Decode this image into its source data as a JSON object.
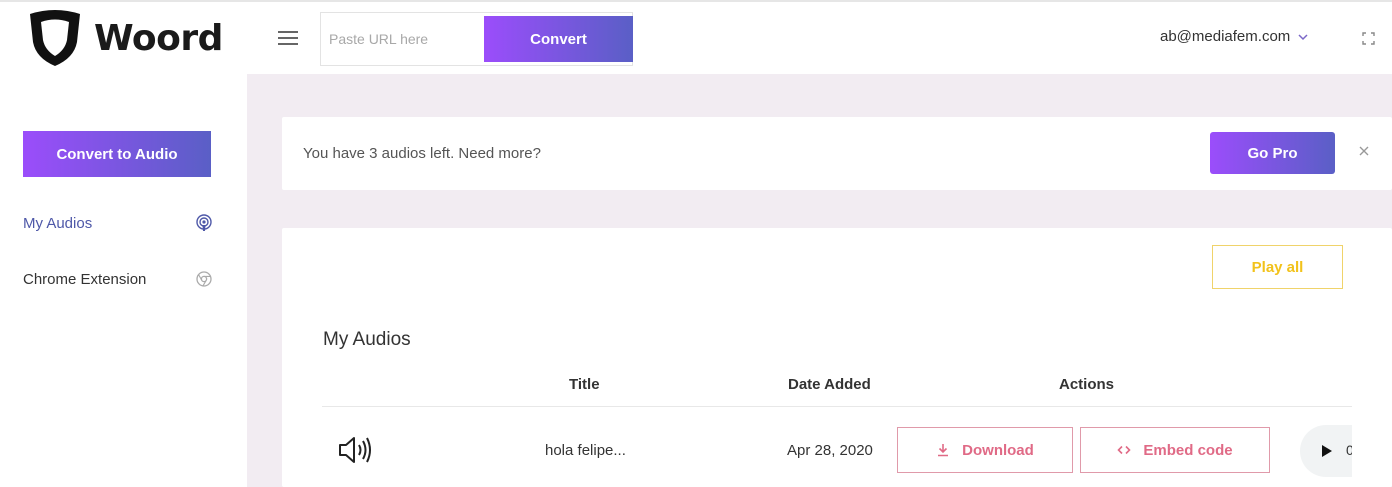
{
  "header": {
    "logo_text": "Woord",
    "url_placeholder": "Paste URL here",
    "convert_label": "Convert",
    "user_email": "ab@mediafem.com"
  },
  "sidebar": {
    "convert_label": "Convert to Audio",
    "items": [
      {
        "label": "My Audios",
        "icon": "podcast-icon",
        "active": true
      },
      {
        "label": "Chrome Extension",
        "icon": "chrome-icon",
        "active": false
      }
    ]
  },
  "alert": {
    "message": "You have 3 audios left. Need more?",
    "cta_label": "Go Pro"
  },
  "audios": {
    "play_all_label": "Play all",
    "title": "My Audios",
    "columns": [
      "Title",
      "Date Added",
      "Actions"
    ],
    "rows": [
      {
        "title": "hola felipe...",
        "date": "Apr 28, 2020",
        "download_label": "Download",
        "embed_label": "Embed code",
        "player_time": "0"
      }
    ]
  },
  "colors": {
    "accent_start": "#9b4dfb",
    "accent_end": "#5a5fc6",
    "active_nav": "#4e58a8",
    "play_all": "#f2c21b",
    "action_pink": "#e06a86",
    "main_bg": "#f2ecf2"
  }
}
